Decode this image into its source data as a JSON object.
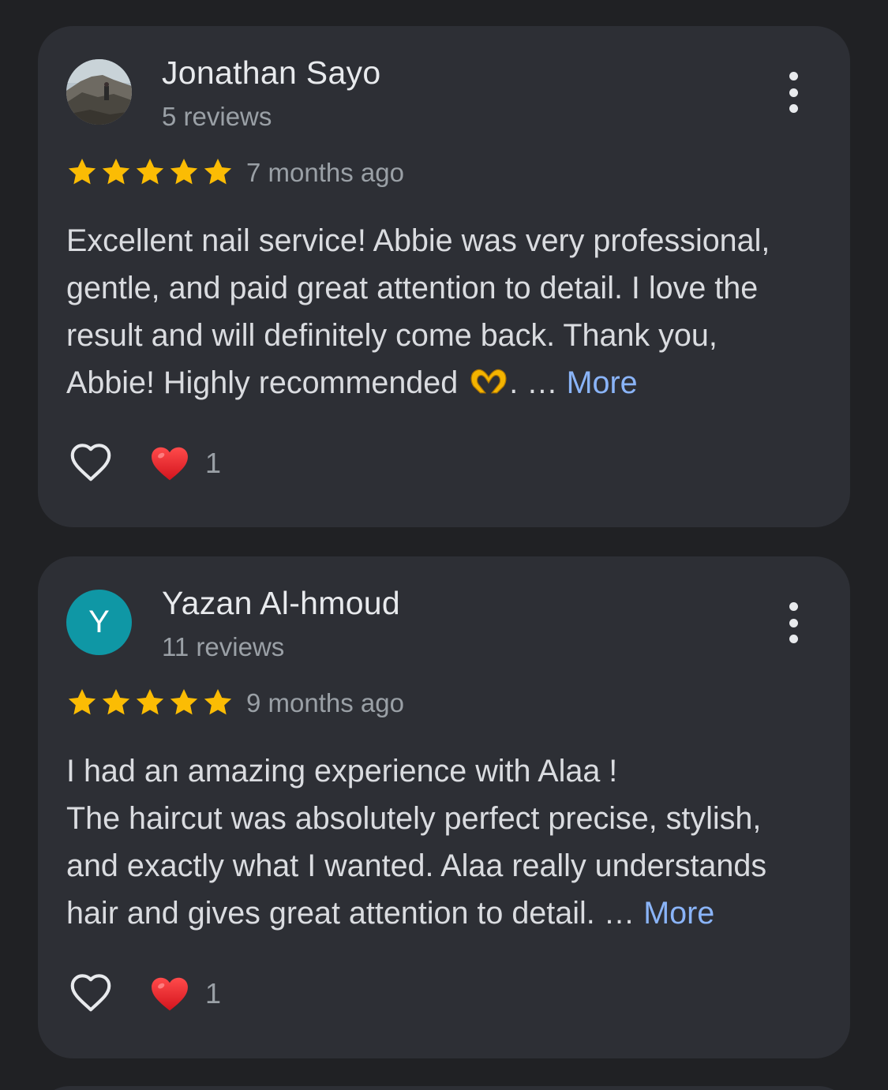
{
  "colors": {
    "background": "#202124",
    "card": "#2d2f35",
    "star": "#fbbc04",
    "link": "#8ab4f8",
    "avatar_teal": "#0f97a5",
    "heart_red": "#e8202a"
  },
  "reviews": [
    {
      "author": "Jonathan Sayo",
      "review_count": "5 reviews",
      "avatar": "photo-avatar",
      "rating": 5,
      "time_ago": "7 months ago",
      "text_lines": [
        "Excellent nail service! Abbie was very professional,",
        "gentle, and paid great attention to detail. I love the",
        "result and will definitely come back. Thank you,",
        "Abbie! Highly recommended"
      ],
      "trailing": ". … ",
      "more_label": "More",
      "emoji": "heart-hands-icon",
      "reaction_icon": "red-heart-icon",
      "reaction_count": "1"
    },
    {
      "author": "Yazan Al-hmoud",
      "review_count": "11 reviews",
      "avatar_letter": "Y",
      "rating": 5,
      "time_ago": "9 months ago",
      "text_lines": [
        "I had an amazing experience with Alaa !",
        "The haircut was absolutely perfect precise, stylish,",
        "and exactly what I wanted. Alaa really understands",
        "hair and gives great attention to detail."
      ],
      "trailing": " … ",
      "more_label": "More",
      "reaction_icon": "red-heart-icon",
      "reaction_count": "1"
    }
  ],
  "icons": {
    "menu": "more-vert-icon",
    "like": "heart-outline-icon",
    "star": "star-icon"
  }
}
